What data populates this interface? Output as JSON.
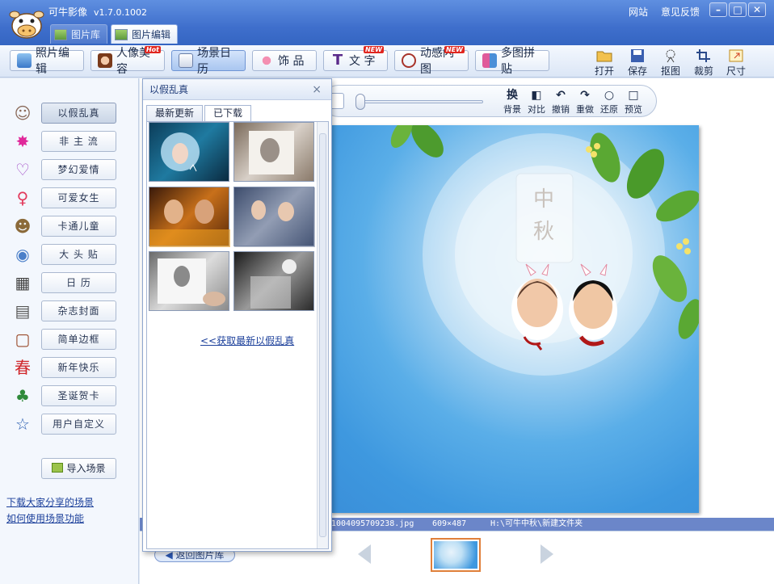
{
  "app": {
    "title": "可牛影像",
    "version": "v1.7.0.1002",
    "links": [
      "网站",
      "意见反馈"
    ]
  },
  "window_controls": [
    "–",
    "□",
    "✕"
  ],
  "tabs": [
    {
      "label": "图片库",
      "icon": "photo-library-icon"
    },
    {
      "label": "图片编辑",
      "icon": "photo-edit-icon"
    }
  ],
  "toolbar": {
    "buttons": [
      {
        "label": "照片编辑",
        "icon": "photo-edit-icon"
      },
      {
        "label": "人像美容",
        "icon": "portrait-icon",
        "badge": "Hot"
      },
      {
        "label": "场景日历",
        "icon": "calendar-icon"
      },
      {
        "label": "饰 品",
        "icon": "bow-icon"
      },
      {
        "label": "文 字",
        "icon": "text-icon",
        "badge": "NEW"
      },
      {
        "label": "动感闪图",
        "icon": "flash-icon",
        "badge": "NEW"
      },
      {
        "label": "多图拼贴",
        "icon": "collage-icon"
      }
    ],
    "right_tools": [
      {
        "label": "打开",
        "icon": "open-folder-icon"
      },
      {
        "label": "保存",
        "icon": "save-icon"
      },
      {
        "label": "抠图",
        "icon": "cutout-icon"
      },
      {
        "label": "裁剪",
        "icon": "crop-icon"
      },
      {
        "label": "尺寸",
        "icon": "resize-icon"
      }
    ]
  },
  "sidebar": {
    "scenes": [
      {
        "label": "以假乱真",
        "icon": "face-icon",
        "glyph": "☺",
        "color": "#8a6a5a"
      },
      {
        "label": "非 主 流",
        "icon": "star-burst-icon",
        "glyph": "✸",
        "color": "#e0289a"
      },
      {
        "label": "梦幻爱情",
        "icon": "heart-icon",
        "glyph": "♡",
        "color": "#a24cc7"
      },
      {
        "label": "可爱女生",
        "icon": "female-icon",
        "glyph": "♀",
        "color": "#e23a5c"
      },
      {
        "label": "卡通儿童",
        "icon": "cartoon-icon",
        "glyph": "☻",
        "color": "#8b6a3a"
      },
      {
        "label": "大 头 贴",
        "icon": "sticker-photo-icon",
        "glyph": "◉",
        "color": "#4a7fc9"
      },
      {
        "label": "日 历",
        "icon": "calendar-18-icon",
        "glyph": "▦",
        "color": "#444444"
      },
      {
        "label": "杂志封面",
        "icon": "magazine-icon",
        "glyph": "▤",
        "color": "#555555"
      },
      {
        "label": "简单边框",
        "icon": "frame-icon",
        "glyph": "▢",
        "color": "#9a4a2a"
      },
      {
        "label": "新年快乐",
        "icon": "spring-icon",
        "glyph": "春",
        "color": "#d0262a"
      },
      {
        "label": "圣诞贺卡",
        "icon": "xmas-tree-icon",
        "glyph": "♣",
        "color": "#2f8a3a"
      },
      {
        "label": "用户自定义",
        "icon": "star-outline-icon",
        "glyph": "☆",
        "color": "#2a5db0"
      }
    ],
    "import_label": "导入场景",
    "link_download": "下载大家分享的场景",
    "link_howto": "如何使用场景功能"
  },
  "subtools": [
    {
      "label": "背景",
      "glyph": "换"
    },
    {
      "label": "对比",
      "glyph": "◧"
    },
    {
      "label": "撤销",
      "glyph": "↶"
    },
    {
      "label": "重做",
      "glyph": "↷"
    },
    {
      "label": "还原",
      "glyph": "○"
    },
    {
      "label": "预览",
      "glyph": "□"
    }
  ],
  "canvas_text": {
    "line1": "中",
    "line2": "秋"
  },
  "status": {
    "filename": "1004095709238.jpg",
    "dimensions": "609×487",
    "path": "H:\\可牛中秋\\新建文件夹"
  },
  "bottom": {
    "back_label": "返回图片库"
  },
  "panel": {
    "title": "以假乱真",
    "close": "×",
    "tabs": [
      "最新更新",
      "已下载"
    ],
    "active_tab": 1,
    "link": "<<获取最新以假乱真"
  }
}
